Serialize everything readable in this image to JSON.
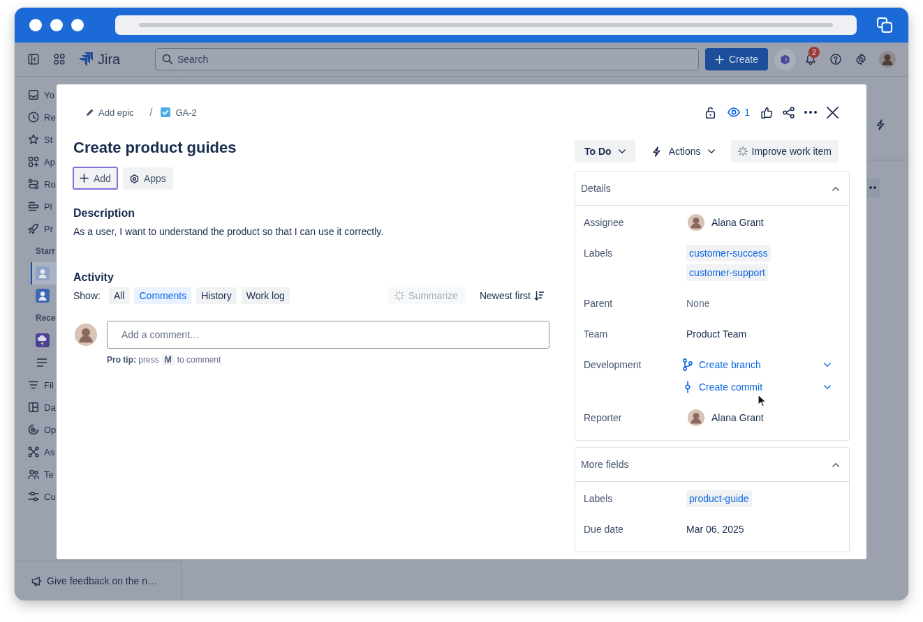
{
  "app_header": {
    "product": "Jira",
    "search": {
      "placeholder": "Search"
    },
    "create_button": "Create",
    "notification_count": "2"
  },
  "sidebar": {
    "items": [
      {
        "label": "Yo",
        "selected": false
      },
      {
        "label": "Re",
        "selected": false
      },
      {
        "label": "St",
        "selected": false
      },
      {
        "label": "Ap",
        "selected": false
      },
      {
        "label": "Ro",
        "selected": false
      },
      {
        "label": "Pl",
        "selected": false
      },
      {
        "label": "Pr",
        "selected": false
      }
    ],
    "starred": {
      "heading": "Starr",
      "items": [
        {
          "color": "#8ea2c8",
          "selected": true
        },
        {
          "color": "#3a68b4",
          "selected": false
        }
      ]
    },
    "recent": {
      "heading": "Rece",
      "items": [
        {
          "kind": "project",
          "color": "#4b4196",
          "selected": false
        },
        {
          "kind": "list",
          "selected": false
        }
      ]
    },
    "more_items": [
      {
        "label": "Fil",
        "selected": false
      },
      {
        "label": "Da",
        "selected": false
      },
      {
        "label": "Op",
        "selected": false
      },
      {
        "label": "As",
        "selected": false
      },
      {
        "label": "Te",
        "selected": false
      },
      {
        "label": "Cu",
        "selected": false
      }
    ],
    "footer": "Give feedback on the n…"
  },
  "work_item": {
    "breadcrumb": {
      "epic": "Add epic",
      "separator": "/",
      "key": "GA-2"
    },
    "watchers": "1",
    "title": "Create product guides",
    "quick_actions": [
      {
        "kind": "add",
        "label": "Add",
        "focused": true
      },
      {
        "kind": "apps",
        "label": "Apps",
        "focused": false
      }
    ],
    "description": {
      "heading": "Description",
      "text": "As a user, I want to understand the product so that I can use it correctly."
    },
    "activity": {
      "heading": "Activity",
      "show_label": "Show:",
      "filters": [
        {
          "label": "All",
          "selected": false
        },
        {
          "label": "Comments",
          "selected": true
        },
        {
          "label": "History",
          "selected": false
        },
        {
          "label": "Work log",
          "selected": false
        }
      ],
      "summarize": {
        "label": "Summarize",
        "disabled": true
      },
      "sort": "Newest first",
      "comment": {
        "placeholder": "Add a comment…"
      },
      "pro_tip": {
        "text": "**Pro tip:** press",
        "key": "M",
        "suffix": "to comment"
      }
    },
    "status": "To Do",
    "actions": "Actions",
    "improve": "Improve work item",
    "panels": [
      {
        "title": "Details",
        "expanded": true,
        "fields": [
          {
            "kind": "user",
            "label": "Assignee",
            "value": "Alana Grant"
          },
          {
            "kind": "labels",
            "label": "Labels",
            "values": [
              "customer-success",
              "customer-support"
            ]
          },
          {
            "kind": "empty",
            "label": "Parent",
            "value": "None"
          },
          {
            "kind": "text",
            "label": "Team",
            "value": "Product Team"
          },
          {
            "kind": "development",
            "label": "Development",
            "links": [
              {
                "kind": "branch",
                "label": "Create branch"
              },
              {
                "kind": "commit",
                "label": "Create commit"
              }
            ]
          },
          {
            "kind": "user",
            "label": "Reporter",
            "value": "Alana Grant"
          }
        ]
      },
      {
        "title": "More fields",
        "expanded": true,
        "fields": [
          {
            "kind": "labels",
            "label": "Labels",
            "values": [
              "product-guide"
            ]
          },
          {
            "kind": "text",
            "label": "Due date",
            "value": "Mar 06, 2025"
          }
        ]
      }
    ]
  }
}
